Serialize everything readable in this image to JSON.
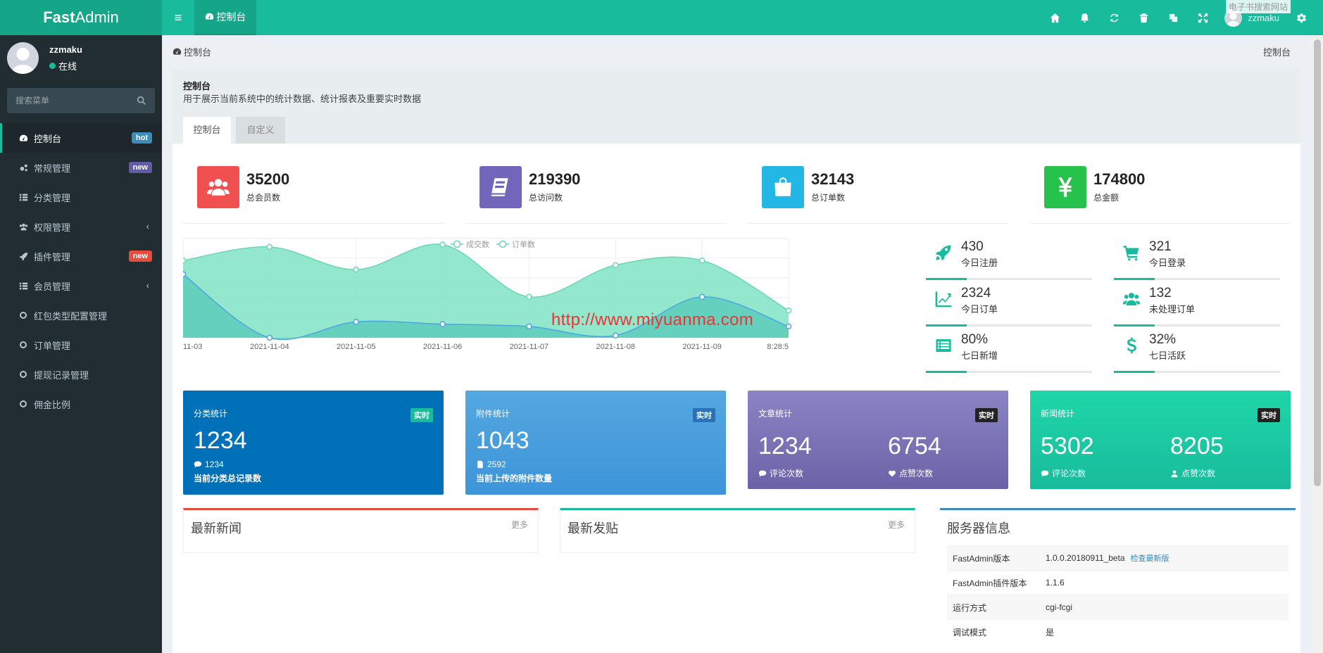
{
  "app": {
    "logo_bold": "Fast",
    "logo_rest": "Admin"
  },
  "topbar": {
    "nav_tab": "控制台",
    "user": "zzmaku",
    "watermark": "电子书搜索网站"
  },
  "sidebar": {
    "user_name": "zzmaku",
    "status": "在线",
    "search_placeholder": "搜索菜单",
    "items": [
      {
        "label": "控制台",
        "icon": "dashboard-icon",
        "badge": "hot",
        "badge_color": "#3c8dbc"
      },
      {
        "label": "常规管理",
        "icon": "cogs-icon",
        "badge": "new",
        "badge_color": "#605ca8"
      },
      {
        "label": "分类管理",
        "icon": "list-icon"
      },
      {
        "label": "权限管理",
        "icon": "users-icon",
        "chevron": "‹"
      },
      {
        "label": "插件管理",
        "icon": "rocket-icon",
        "badge": "new",
        "badge_color": "#e74c3c"
      },
      {
        "label": "会员管理",
        "icon": "list-icon",
        "chevron": "‹"
      },
      {
        "label": "红包类型配置管理",
        "icon": "circle-icon"
      },
      {
        "label": "订单管理",
        "icon": "circle-icon"
      },
      {
        "label": "提现记录管理",
        "icon": "circle-icon"
      },
      {
        "label": "佣金比例",
        "icon": "circle-icon"
      }
    ]
  },
  "breadcrumb": {
    "left": "控制台",
    "right": "控制台"
  },
  "panel": {
    "title": "控制台",
    "desc": "用于展示当前系统中的统计数据、统计报表及重要实时数据",
    "tabs": [
      "控制台",
      "自定义"
    ]
  },
  "stats": [
    {
      "value": "35200",
      "label": "总会员数",
      "color": "#f05050",
      "icon": "users-icon"
    },
    {
      "value": "219390",
      "label": "总访问数",
      "color": "#7266ba",
      "icon": "book-icon"
    },
    {
      "value": "32143",
      "label": "总订单数",
      "color": "#23b7e5",
      "icon": "shopping-bag-icon"
    },
    {
      "value": "174800",
      "label": "总金额",
      "color": "#27c24c",
      "icon": "yen-icon"
    }
  ],
  "chart_data": {
    "type": "area",
    "legend": [
      "成交数",
      "订单数"
    ],
    "legend_position": "top-center",
    "x": [
      "11-03",
      "2021-11-04",
      "2021-11-05",
      "2021-11-06",
      "2021-11-07",
      "2021-11-08",
      "2021-11-09",
      "8:28:5"
    ],
    "series": [
      {
        "name": "订单数",
        "color": "#7fe3c3",
        "values": [
          170,
          200,
          150,
          205,
          90,
          160,
          170,
          60
        ]
      },
      {
        "name": "成交数",
        "color": "#56c8b8",
        "values": [
          140,
          0,
          35,
          30,
          25,
          5,
          90,
          25
        ]
      }
    ],
    "ylim": [
      0,
      220
    ],
    "grid": true
  },
  "chart_watermark": "http://www.miyuanma.com",
  "mini_stats": [
    {
      "value": "430",
      "label": "今日注册",
      "icon": "rocket-icon"
    },
    {
      "value": "321",
      "label": "今日登录",
      "icon": "cart-icon"
    },
    {
      "value": "2324",
      "label": "今日订单",
      "icon": "line-chart-icon"
    },
    {
      "value": "132",
      "label": "未处理订单",
      "icon": "users-icon"
    },
    {
      "value": "80%",
      "label": "七日新增",
      "icon": "list-alt-icon"
    },
    {
      "value": "32%",
      "label": "七日活跃",
      "icon": "dollar-icon"
    }
  ],
  "cards": [
    {
      "title": "分类统计",
      "tag": "实时",
      "value": "1234",
      "sub": "1234",
      "desc": "当前分类总记录数"
    },
    {
      "title": "附件统计",
      "tag": "实时",
      "value": "1043",
      "sub": "2592",
      "desc": "当前上传的附件数量"
    },
    {
      "title": "文章统计",
      "tag": "实时",
      "v1": "1234",
      "l1": "评论次数",
      "v2": "6754",
      "l2": "点赞次数"
    },
    {
      "title": "新闻统计",
      "tag": "实时",
      "v1": "5302",
      "l1": "评论次数",
      "v2": "8205",
      "l2": "点赞次数"
    }
  ],
  "boxes": [
    {
      "title": "最新新闻",
      "more": "更多"
    },
    {
      "title": "最新发贴",
      "more": "更多"
    }
  ],
  "server": {
    "title": "服务器信息",
    "rows": [
      {
        "k": "FastAdmin版本",
        "v": "1.0.0.20180911_beta",
        "link": "检查最新版"
      },
      {
        "k": "FastAdmin插件版本",
        "v": "1.1.6"
      },
      {
        "k": "运行方式",
        "v": "cgi-fcgi"
      },
      {
        "k": "调试模式",
        "v": "是"
      }
    ]
  }
}
